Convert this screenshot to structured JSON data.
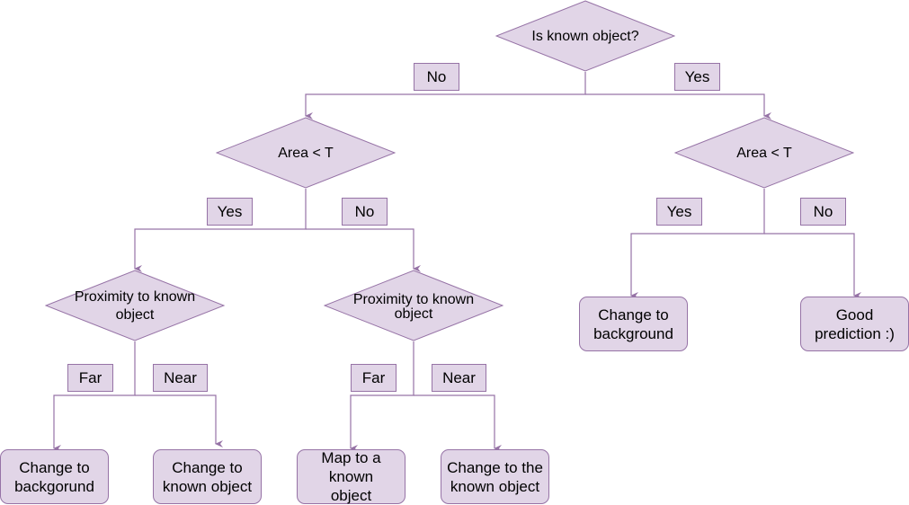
{
  "colors": {
    "fill": "#e1d5e7",
    "stroke": "#9673a6",
    "text": "#000000"
  },
  "nodes": {
    "root": "Is known object?",
    "left_area": "Area < T",
    "right_area": "Area < T",
    "prox_left": "Proximity to known object",
    "prox_right": "Proximity to known object",
    "leaf_ll": "Change to backgorund",
    "leaf_lr": "Change to known object",
    "leaf_rl": "Map to a known object",
    "leaf_rr": "Change to the known object",
    "leaf_right_yes": "Change to background",
    "leaf_right_no": "Good prediction :)"
  },
  "edge_labels": {
    "root_no": "No",
    "root_yes": "Yes",
    "left_area_yes": "Yes",
    "left_area_no": "No",
    "right_area_yes": "Yes",
    "right_area_no": "No",
    "prox_left_far": "Far",
    "prox_left_near": "Near",
    "prox_right_far": "Far",
    "prox_right_near": "Near"
  }
}
